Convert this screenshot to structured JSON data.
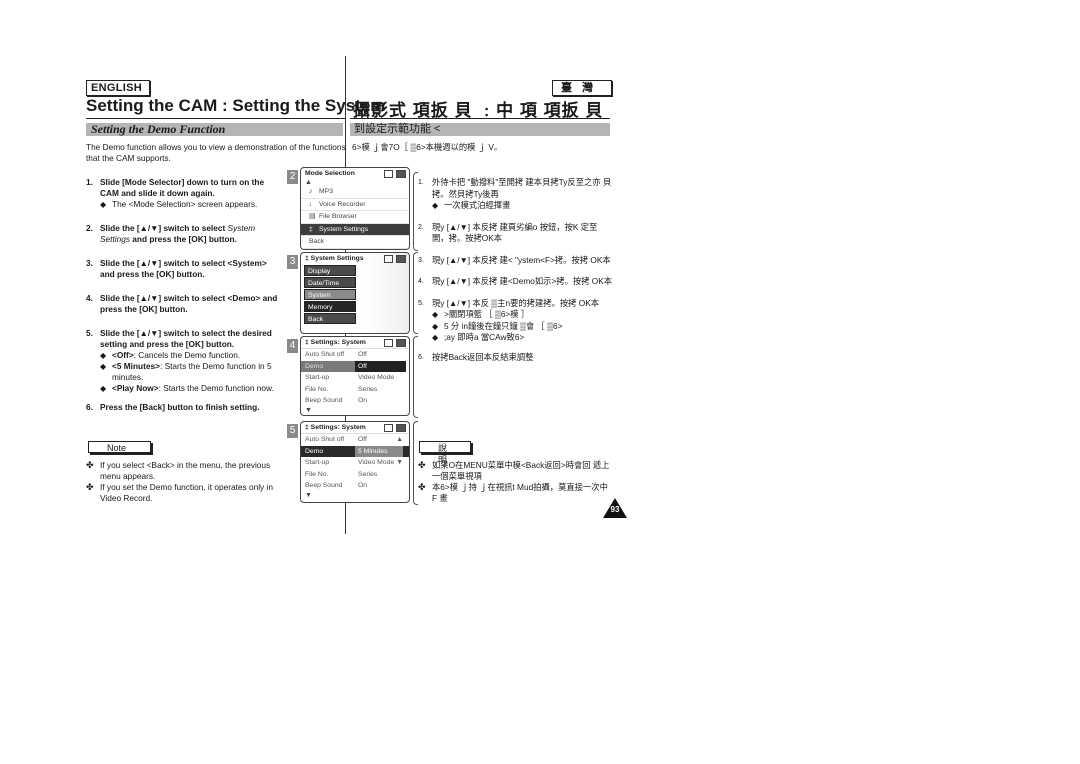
{
  "header": {
    "lang_en": "ENGLISH",
    "lang_tw": "臺灣",
    "title_en": "Setting the CAM : Setting the System",
    "title_tw": "攝影式 項扳 貝 ﹕中 項 項扳 貝"
  },
  "section": {
    "title_en": "Setting the Demo Function",
    "title_tw": "到設定示範功能 <"
  },
  "intro": {
    "en": "The Demo function allows you to view a demonstration of the functions that the CAM supports.",
    "tw": "6>模 ｊ會7O［ ▒6>本機週以的模 ｊ V。"
  },
  "steps_en": [
    {
      "num": "1.",
      "text": "Slide [Mode Selector] down to turn on the CAM and slide it down again.",
      "bullets": [
        {
          "bold": "",
          "text": "The <Mode Selection> screen appears."
        }
      ]
    },
    {
      "num": "2.",
      "text": "Slide the [▲/▼] switch to select ",
      "italic": "System Settings",
      "text2": " and press the [OK] button.",
      "bullets": []
    },
    {
      "num": "3.",
      "text": "Slide the [▲/▼] switch to select <System> and press the [OK] button.",
      "bullets": []
    },
    {
      "num": "4.",
      "text": "Slide the [▲/▼] switch to select <Demo> and press the [OK] button.",
      "bullets": []
    },
    {
      "num": "5.",
      "text": "Slide the [▲/▼] switch to select the desired setting and press the [OK] button.",
      "bullets": [
        {
          "bold": "<Off>",
          "text": ": Cancels the Demo function."
        },
        {
          "bold": "<5 Minutes>",
          "text": ": Starts the Demo function in 5 minutes."
        },
        {
          "bold": "<Play Now>",
          "text": ": Starts the Demo function now."
        }
      ]
    },
    {
      "num": "6.",
      "text": "Press the [Back] button to finish setting.",
      "bullets": []
    }
  ],
  "steps_tw": [
    {
      "num": "1.",
      "text": "外待卡把 \"動撥料\"至開拷 建本貝拷Ty反至之亦 貝拷。然貝拷Ty後再",
      "bullets": [
        "一次模式泊經揮畫"
      ]
    },
    {
      "num": "2.",
      "text": "現y [▲/▼] 本反拷 建頁劣編o 按鈕，按K 定至開，拷。按拷OK本",
      "bullets": []
    },
    {
      "num": "3.",
      "text": "現y [▲/▼] 本反拷 建< \"ystem<F>拷。按拷 OK本",
      "bullets": []
    },
    {
      "num": "4.",
      "text": "現y [▲/▼] 本反拷 建<Demo如示>拷。按拷 OK本",
      "bullets": []
    },
    {
      "num": "5.",
      "text": "現y [▲/▼] 本反 ▒主n要的拷建拷。按拷 OK本",
      "bullets": [
        ">關閉項籃 ［ ▒6>模 ］",
        "5 分 in鐘後在鐘只鐘 ▒會 ［ ▒6>",
        ";ay 即時a 當CAw致6>"
      ]
    },
    {
      "num": "6.",
      "text": "按拷Back返回本反結束調整",
      "bullets": []
    }
  ],
  "note": {
    "label_en": "Note",
    "label_tw": "說 明",
    "items_en": [
      "If you select <Back> in the menu, the previous menu appears.",
      "If you set the Demo function, it operates only in Video Record."
    ],
    "items_tw": [
      "如果O在MENU菜單中模<Back返回>時會回 遞上 一個菜單視項",
      "本6>模 ｊ持 ｊ在視訊t Mud拍攝，莫直接一次中 F 畫"
    ]
  },
  "screens": [
    {
      "num": "2",
      "title": "Mode Selection",
      "items": [
        {
          "icon": "music-note-icon",
          "glyph": "♪",
          "label": "MP3",
          "selected": false
        },
        {
          "icon": "microphone-icon",
          "glyph": "🎙",
          "label": "Voice Recorder",
          "selected": false
        },
        {
          "icon": "file-icon",
          "glyph": "▤",
          "label": "File Browser",
          "selected": false
        },
        {
          "icon": "settings-icon",
          "glyph": "‡",
          "label": "System Settings",
          "selected": true
        },
        {
          "icon": "",
          "glyph": "",
          "label": "Back",
          "selected": false
        }
      ]
    },
    {
      "num": "3",
      "title": "System Settings",
      "items": [
        "Display",
        "Date/Time",
        "System",
        "Memory",
        "Back"
      ],
      "selected_index": 2
    },
    {
      "num": "4",
      "title": "Settings: System",
      "rows": [
        {
          "key": "Auto Shut off",
          "value": "Off"
        },
        {
          "key": "Demo",
          "value": "Off"
        },
        {
          "key": "Start-up",
          "value": "Video Mode"
        },
        {
          "key": "File No.",
          "value": "Series"
        },
        {
          "key": "Beep Sound",
          "value": "On"
        }
      ],
      "selected_index": 1
    },
    {
      "num": "5",
      "title": "Settings: System",
      "rows": [
        {
          "key": "Auto Shut off",
          "value": "Off"
        },
        {
          "key": "Demo",
          "value": "5 Minutes"
        },
        {
          "key": "Start-up",
          "value": "Video Mode"
        },
        {
          "key": "File No.",
          "value": "Series"
        },
        {
          "key": "Beep Sound",
          "value": "On"
        }
      ],
      "selected_index": 1
    }
  ],
  "page_number": "93"
}
